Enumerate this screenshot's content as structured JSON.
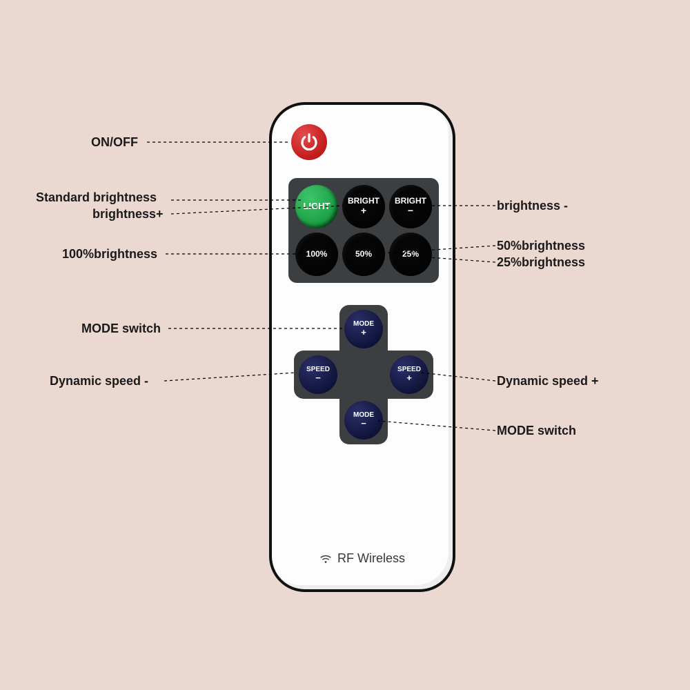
{
  "remote": {
    "buttons": {
      "light": "LIGHT",
      "bright_plus_top": "BRIGHT",
      "bright_plus_sym": "+",
      "bright_minus_top": "BRIGHT",
      "bright_minus_sym": "−",
      "p100": "100%",
      "p50": "50%",
      "p25": "25%"
    },
    "dpad": {
      "mode_plus_top": "MODE",
      "mode_plus_sym": "+",
      "mode_minus_top": "MODE",
      "mode_minus_sym": "−",
      "speed_plus_top": "SPEED",
      "speed_plus_sym": "+",
      "speed_minus_top": "SPEED",
      "speed_minus_sym": "−"
    },
    "footer": "RF Wireless"
  },
  "labels": {
    "onoff": "ON/OFF",
    "std_bright": "Standard brightness",
    "bright_plus": "brightness+",
    "bright_minus": "brightness -",
    "p100": "100%brightness",
    "p50": "50%brightness",
    "p25": "25%brightness",
    "mode_switch_top": "MODE switch",
    "mode_switch_bottom": "MODE switch",
    "speed_minus": "Dynamic speed -",
    "speed_plus": "Dynamic speed +"
  }
}
